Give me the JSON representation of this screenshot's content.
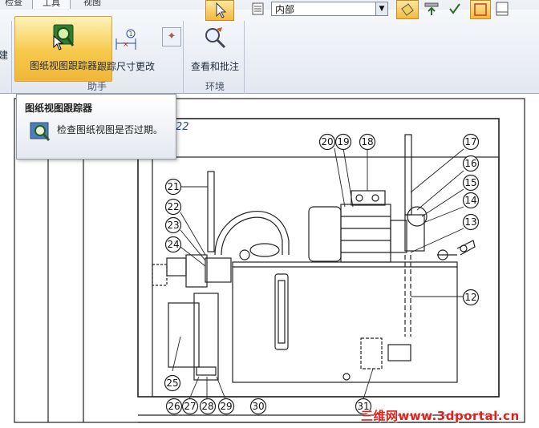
{
  "ribbon": {
    "tabs": [
      {
        "label": "检查"
      },
      {
        "label": "工具"
      },
      {
        "label": "视图"
      }
    ],
    "partial_button_label": "建",
    "buttons": {
      "tracker": "图纸视图跟踪器",
      "dim_track": "跟踪尺寸更改",
      "review": "查看和批注"
    },
    "groups": {
      "assistant": "助手",
      "environment": "环境"
    }
  },
  "toolbar": {
    "layer_value": "内部"
  },
  "tooltip": {
    "title": "图纸视图跟踪器",
    "description": "检查图纸视图是否过期。"
  },
  "drawing": {
    "ref_text": "22",
    "balloons": [
      "20",
      "19",
      "18",
      "17",
      "16",
      "15",
      "14",
      "13",
      "12",
      "21",
      "22",
      "23",
      "24",
      "25",
      "26",
      "27",
      "28",
      "29",
      "30",
      "31"
    ]
  },
  "watermark": "三维网www.3dportal.cn",
  "colors": {
    "accent_orange": "#f5b840",
    "ribbon_bg": "#e3e8f0",
    "drawing_line": "#222222",
    "watermark": "#e0201a"
  }
}
